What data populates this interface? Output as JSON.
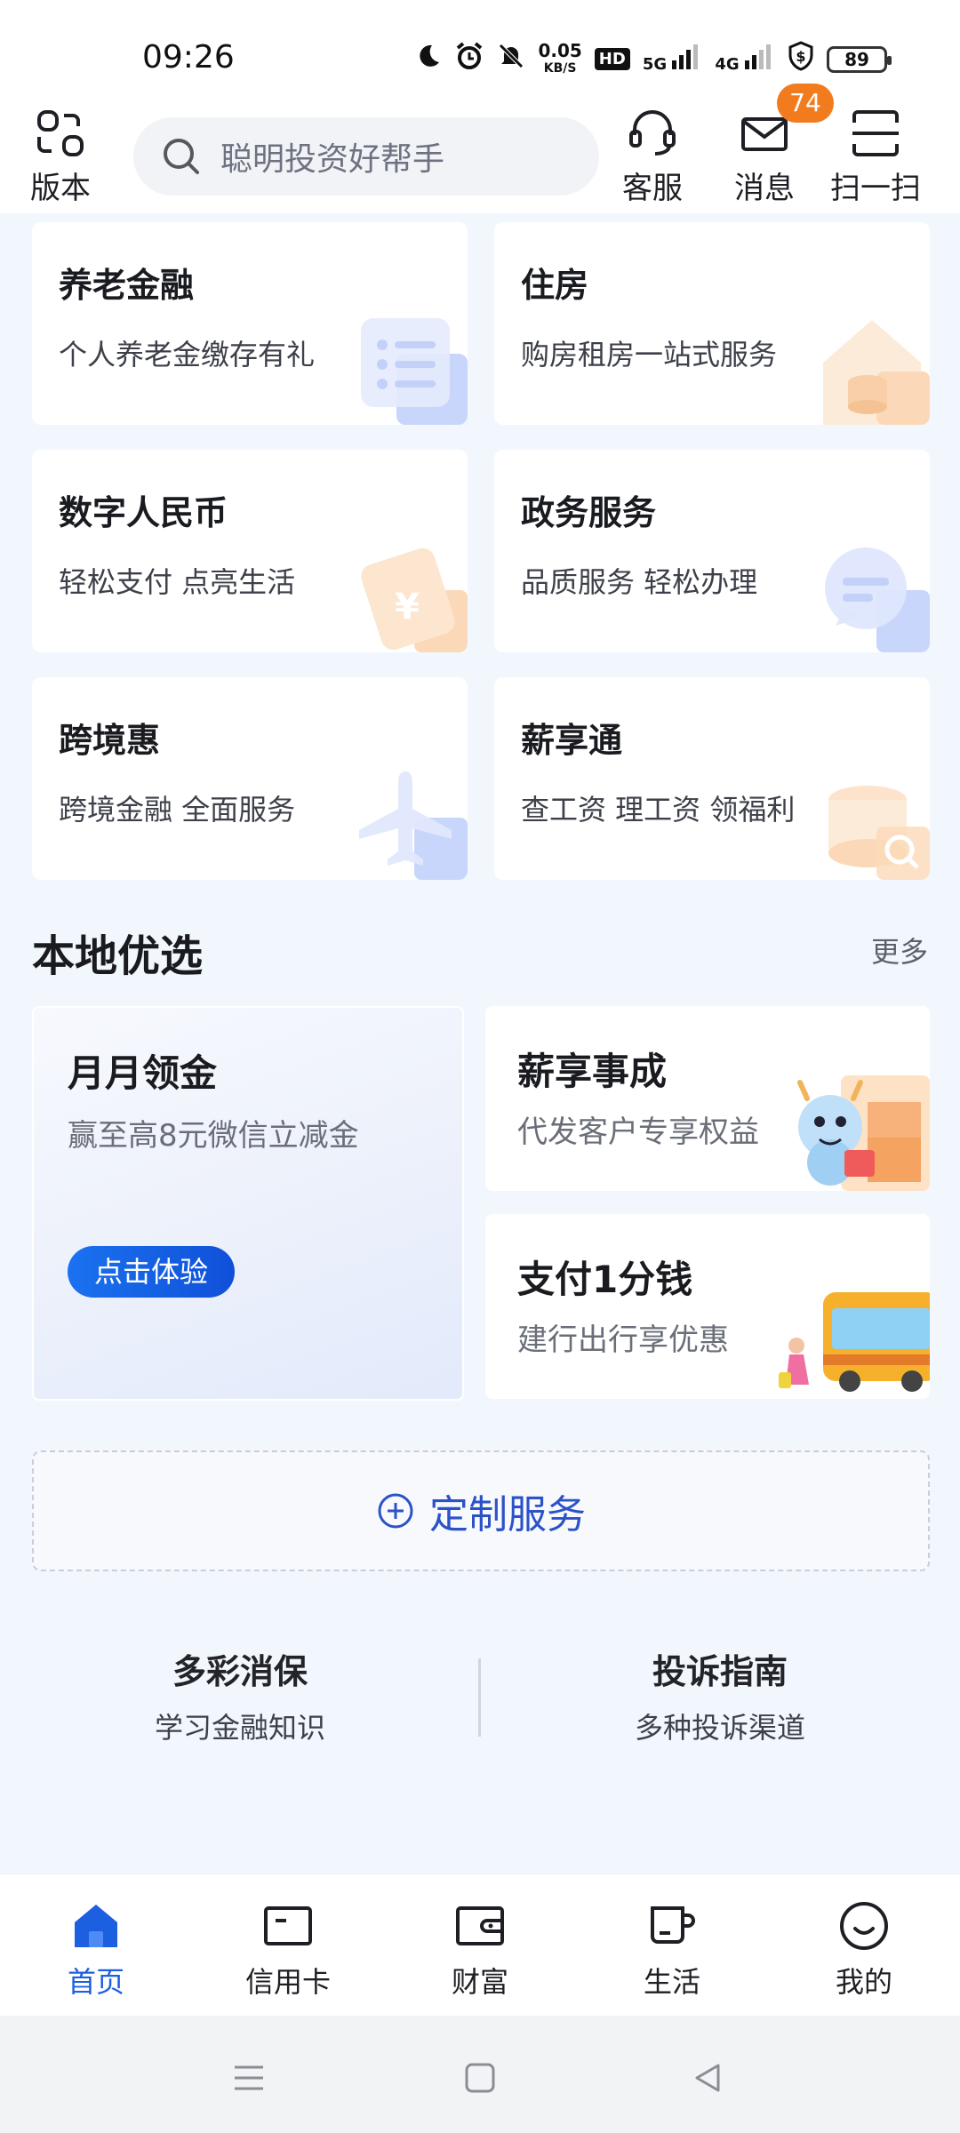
{
  "status_bar": {
    "time": "09:26",
    "net_speed_value": "0.05",
    "net_speed_unit": "KB/S",
    "hd_label": "HD",
    "signal_5g": "5G",
    "signal_4g": "4G",
    "battery": "89"
  },
  "header": {
    "version_label": "版本",
    "search_placeholder": "聪明投资好帮手",
    "service_label": "客服",
    "message_label": "消息",
    "message_badge": "74",
    "scan_label": "扫一扫"
  },
  "service_cards": [
    {
      "title": "养老金融",
      "subtitle": "个人养老金缴存有礼"
    },
    {
      "title": "住房",
      "subtitle": "购房租房一站式服务"
    },
    {
      "title": "数字人民币",
      "subtitle": "轻松支付 点亮生活"
    },
    {
      "title": "政务服务",
      "subtitle": "品质服务 轻松办理"
    },
    {
      "title": "跨境惠",
      "subtitle": "跨境金融  全面服务"
    },
    {
      "title": "薪享通",
      "subtitle": "查工资 理工资 领福利"
    }
  ],
  "local_section": {
    "title": "本地优选",
    "more": "更多",
    "big_promo": {
      "title": "月月领金",
      "subtitle": "赢至高8元微信立减金",
      "cta": "点击体验"
    },
    "small_promos": [
      {
        "title": "薪享事成",
        "subtitle": "代发客户专享权益"
      },
      {
        "title": "支付1分钱",
        "subtitle": "建行出行享优惠"
      }
    ]
  },
  "custom_service": {
    "label": "定制服务"
  },
  "guides": [
    {
      "title": "多彩消保",
      "subtitle": "学习金融知识"
    },
    {
      "title": "投诉指南",
      "subtitle": "多种投诉渠道"
    }
  ],
  "tabbar": {
    "tabs": [
      {
        "label": "首页",
        "icon": "home-icon"
      },
      {
        "label": "信用卡",
        "icon": "credit-card-icon"
      },
      {
        "label": "财富",
        "icon": "wallet-icon"
      },
      {
        "label": "生活",
        "icon": "cup-icon"
      },
      {
        "label": "我的",
        "icon": "smile-icon"
      }
    ],
    "active_index": 0
  },
  "colors": {
    "accent": "#1c5fe0",
    "badge": "#f27b1e",
    "background": "#f2f7fd"
  }
}
